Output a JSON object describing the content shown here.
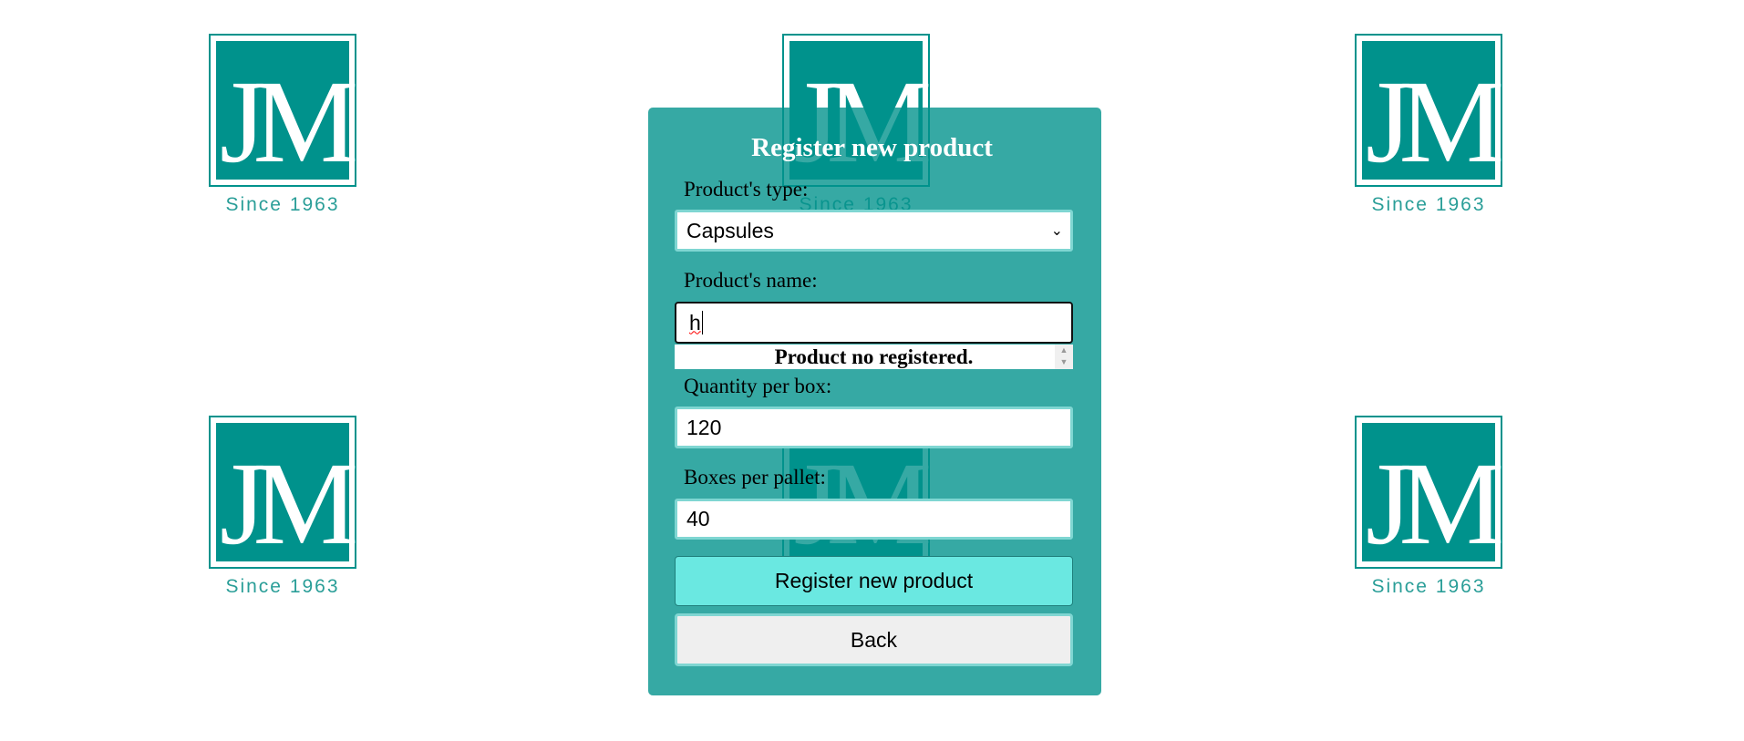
{
  "logo": {
    "monogram": "JM",
    "tagline": "Since 1963",
    "color": "#00928c"
  },
  "form": {
    "title": "Register new product",
    "type_label": "Product's type:",
    "type_value": "Capsules",
    "name_label": "Product's name:",
    "name_value": "h",
    "name_message": "Product no registered.",
    "quantity_label": "Quantity per box:",
    "quantity_value": "120",
    "boxes_label": "Boxes per pallet:",
    "boxes_value": "40",
    "register_button": "Register new product",
    "back_button": "Back"
  }
}
